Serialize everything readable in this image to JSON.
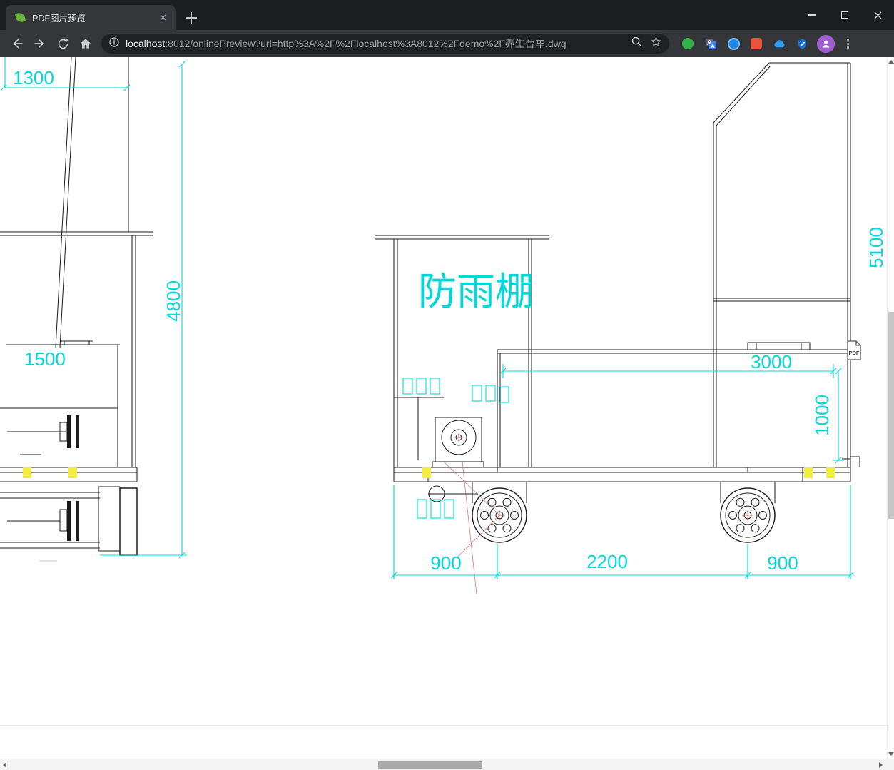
{
  "titlebar": {
    "tab_title": "PDF图片预览"
  },
  "navbar": {
    "url_host": "localhost",
    "url_rest": ":8012/onlinePreview?url=http%3A%2F%2Flocalhost%3A8012%2Fdemo%2F养生台车.dwg"
  },
  "content": {
    "pdf_badge_label": "PDF",
    "drawing": {
      "shelter_title": "防雨棚",
      "dims": {
        "top_left": "1300",
        "left_height": "4800",
        "left_width": "1500",
        "right_height": "5100",
        "platform_length": "3000",
        "platform_height": "1000",
        "bottom_left": "900",
        "bottom_center": "2200",
        "bottom_right": "900"
      }
    }
  },
  "colors": {
    "dimension_cyan": "#00d8d8",
    "highlight_yellow": "#f0ee3c",
    "chrome_dark": "#1d1e22",
    "toolbar_dark": "#35363a"
  }
}
